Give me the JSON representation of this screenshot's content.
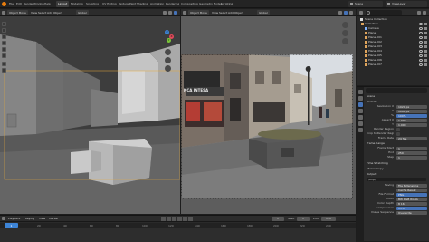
{
  "app": {
    "menu": [
      "File",
      "Edit",
      "Render",
      "Window",
      "Help"
    ],
    "workspace_tabs": [
      "Layout",
      "Modeling",
      "Sculpting",
      "UV Editing",
      "Texture Paint",
      "Shading",
      "Animation",
      "Rendering",
      "Compositing",
      "Geometry Nodes",
      "Scripting"
    ],
    "active_tab": "Layout",
    "scene_name": "Scene",
    "view_layer": "ViewLayer"
  },
  "viewport_left": {
    "mode": "Object Mode",
    "menus": [
      "View",
      "Select",
      "Add",
      "Object"
    ],
    "orientation": "Global",
    "gizmo_axes": [
      "X",
      "Y",
      "Z"
    ]
  },
  "viewport_right": {
    "mode": "Object Mode",
    "menus": [
      "View",
      "Select",
      "Add",
      "Object"
    ],
    "orientation": "Global",
    "sign_text": "NCA INTESA"
  },
  "outliner": {
    "title": "Scene Collection",
    "items": [
      "Collection",
      "Camera",
      "Plane",
      "Plane.001",
      "Plane.002",
      "Plane.003",
      "Plane.004",
      "Plane.005",
      "Plane.006",
      "Plane.007"
    ]
  },
  "properties": {
    "panel_title": "Scene",
    "sections": [
      "Format",
      "Frame Range",
      "Time Stretching",
      "Stereoscopy",
      "Output"
    ],
    "format_rows": [
      {
        "label": "Resolution X",
        "value": "1920 px"
      },
      {
        "label": "Y",
        "value": "1080 px"
      },
      {
        "label": "%",
        "value": "100%"
      },
      {
        "label": "Aspect X",
        "value": "1.000"
      },
      {
        "label": "Y",
        "value": "1.000"
      },
      {
        "label": "Render Region",
        "value": ""
      },
      {
        "label": "Crop to Render Region",
        "value": ""
      },
      {
        "label": "Frame Rate",
        "value": "24 fps"
      }
    ],
    "frame_rows": [
      {
        "label": "Frame Start",
        "value": "1"
      },
      {
        "label": "End",
        "value": "250"
      },
      {
        "label": "Step",
        "value": "1"
      }
    ],
    "output_path": "/tmp/",
    "output_rows": [
      {
        "label": "Saving",
        "value": "File Extensions"
      },
      {
        "label": "",
        "value": "Cache Result"
      },
      {
        "label": "File Format",
        "value": "PNG"
      },
      {
        "label": "Color",
        "value": "BW RGB RGBA"
      },
      {
        "label": "Color Depth",
        "value": "8 16"
      },
      {
        "label": "Compression",
        "value": "15%"
      },
      {
        "label": "Image Sequence",
        "value": "Overwrite"
      }
    ]
  },
  "timeline": {
    "menus": [
      "Playback",
      "Keying",
      "View",
      "Marker"
    ],
    "current_frame": "1",
    "start_label": "Start",
    "start": "1",
    "end_label": "End",
    "end": "250",
    "ticks": [
      "0",
      "20",
      "40",
      "60",
      "80",
      "100",
      "120",
      "140",
      "160",
      "180",
      "200",
      "220",
      "240"
    ]
  },
  "colors": {
    "accent": "#4673b8",
    "active_frame": "#3d84d6",
    "selection_outline": "#e8a93a"
  }
}
